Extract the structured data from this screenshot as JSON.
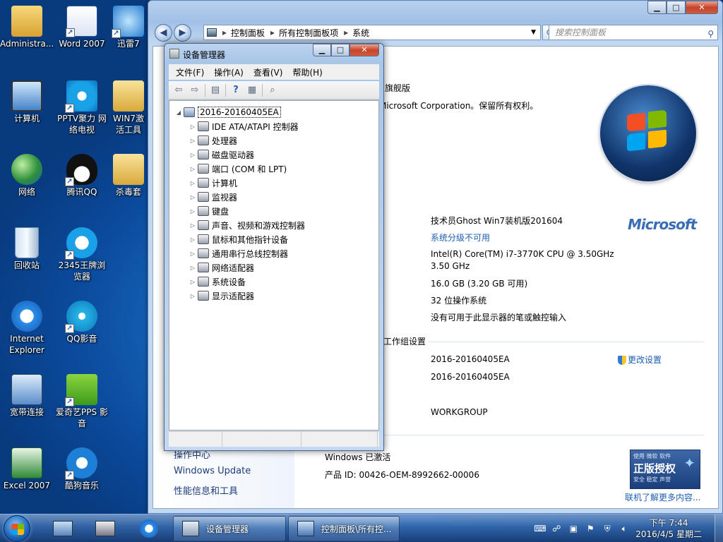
{
  "desktop": {
    "icons": [
      {
        "label": "Administra...",
        "kind": "user"
      },
      {
        "label": "Word 2007",
        "kind": "word"
      },
      {
        "label": "迅雷7",
        "kind": "thunder"
      },
      {
        "label": "计算机",
        "kind": "computer"
      },
      {
        "label": "PPTV聚力 网络电视",
        "kind": "pptv"
      },
      {
        "label": "WIN7激活工具",
        "kind": "folder"
      },
      {
        "label": "网络",
        "kind": "network"
      },
      {
        "label": "腾讯QQ",
        "kind": "qq"
      },
      {
        "label": "杀毒套",
        "kind": "folder"
      },
      {
        "label": "回收站",
        "kind": "recycle"
      },
      {
        "label": "2345王牌浏览器",
        "kind": "ie2345"
      },
      {
        "label": "Internet Explorer",
        "kind": "ie"
      },
      {
        "label": "QQ影音",
        "kind": "qqplayer"
      },
      {
        "label": "宽带连接",
        "kind": "broadband"
      },
      {
        "label": "爱奇艺PPS 影音",
        "kind": "iqiyi"
      },
      {
        "label": "Excel 2007",
        "kind": "excel"
      },
      {
        "label": "酷狗音乐",
        "kind": "kugou"
      }
    ]
  },
  "control_panel": {
    "breadcrumb": [
      "控制面板",
      "所有控制面板项",
      "系统"
    ],
    "search_placeholder": "搜索控制面板",
    "edition_tail": "旗舰版",
    "copyright": "版权所有 © 2009 Microsoft Corporation。保留所有权利。",
    "system_info": {
      "manufacturer": "技术员Ghost Win7装机版201604",
      "rating": "系统分级不可用",
      "processor_line1": "Intel(R) Core(TM) i7-3770K CPU @ 3.50GHz",
      "processor_line2": "3.50 GHz",
      "memory": "16.0 GB (3.20 GB 可用)",
      "system_type": "32 位操作系统",
      "pen_touch": "没有可用于此显示器的笔或触控输入"
    },
    "workgroup_header": "计算机名称、域和工作组设置",
    "computer_name": "2016-20160405EA",
    "full_name": "2016-20160405EA",
    "workgroup": "WORKGROUP",
    "change_settings": "更改设置",
    "activation": "Windows 已激活",
    "product_id": "产品 ID: 00426-OEM-8992662-00006",
    "left_links": [
      "操作中心",
      "Windows Update",
      "性能信息和工具"
    ],
    "ms_logo": "Microsoft",
    "genuine_line1": "使用 微软 软件",
    "genuine_line2": "正版授权",
    "genuine_line3": "安全 稳定 声誉",
    "learn_more": "联机了解更多内容..."
  },
  "device_manager": {
    "title": "设备管理器",
    "menu": [
      "文件(F)",
      "操作(A)",
      "查看(V)",
      "帮助(H)"
    ],
    "root": "2016-20160405EA",
    "devices": [
      "IDE ATA/ATAPI 控制器",
      "处理器",
      "磁盘驱动器",
      "端口 (COM 和 LPT)",
      "计算机",
      "监视器",
      "键盘",
      "声音、视频和游戏控制器",
      "鼠标和其他指针设备",
      "通用串行总线控制器",
      "网络适配器",
      "系统设备",
      "显示适配器"
    ]
  },
  "taskbar": {
    "tasks": [
      "设备管理器",
      "控制面板\\所有控..."
    ],
    "time": "下午 7:44",
    "date": "2016/4/5 星期二"
  }
}
